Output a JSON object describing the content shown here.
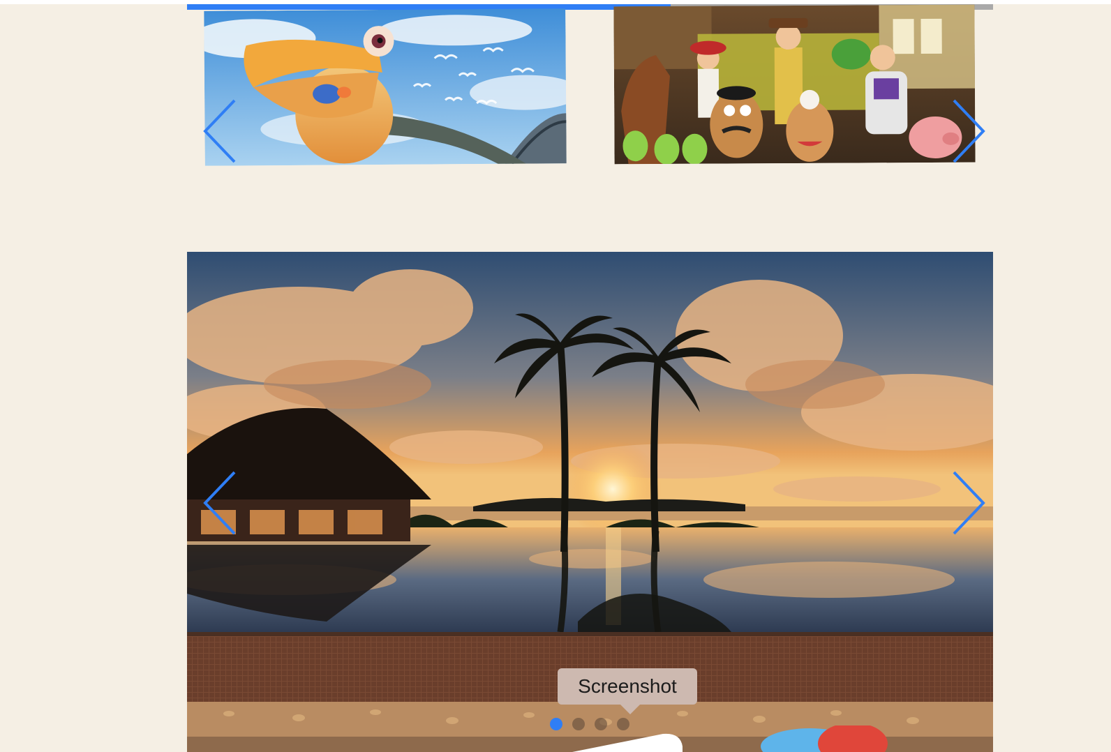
{
  "top_carousel": {
    "progress_fraction": 0.6,
    "slides": [
      {
        "name": "nemo-pelican-image"
      },
      {
        "name": "toy-story-image"
      }
    ],
    "prev_icon": "chevron-left-icon",
    "next_icon": "chevron-right-icon"
  },
  "main_carousel": {
    "slide": "tropical-sunset-infinity-pool-image",
    "prev_icon": "chevron-left-icon",
    "next_icon": "chevron-right-icon",
    "dots_count": 4,
    "active_dot": 0
  },
  "tooltip": {
    "label": "Screenshot"
  },
  "colors": {
    "page_background": "#f5efe4",
    "accent": "#2f7ef5",
    "progress_track": "#a9a9a9",
    "tooltip_background": "#cdb9b0"
  }
}
